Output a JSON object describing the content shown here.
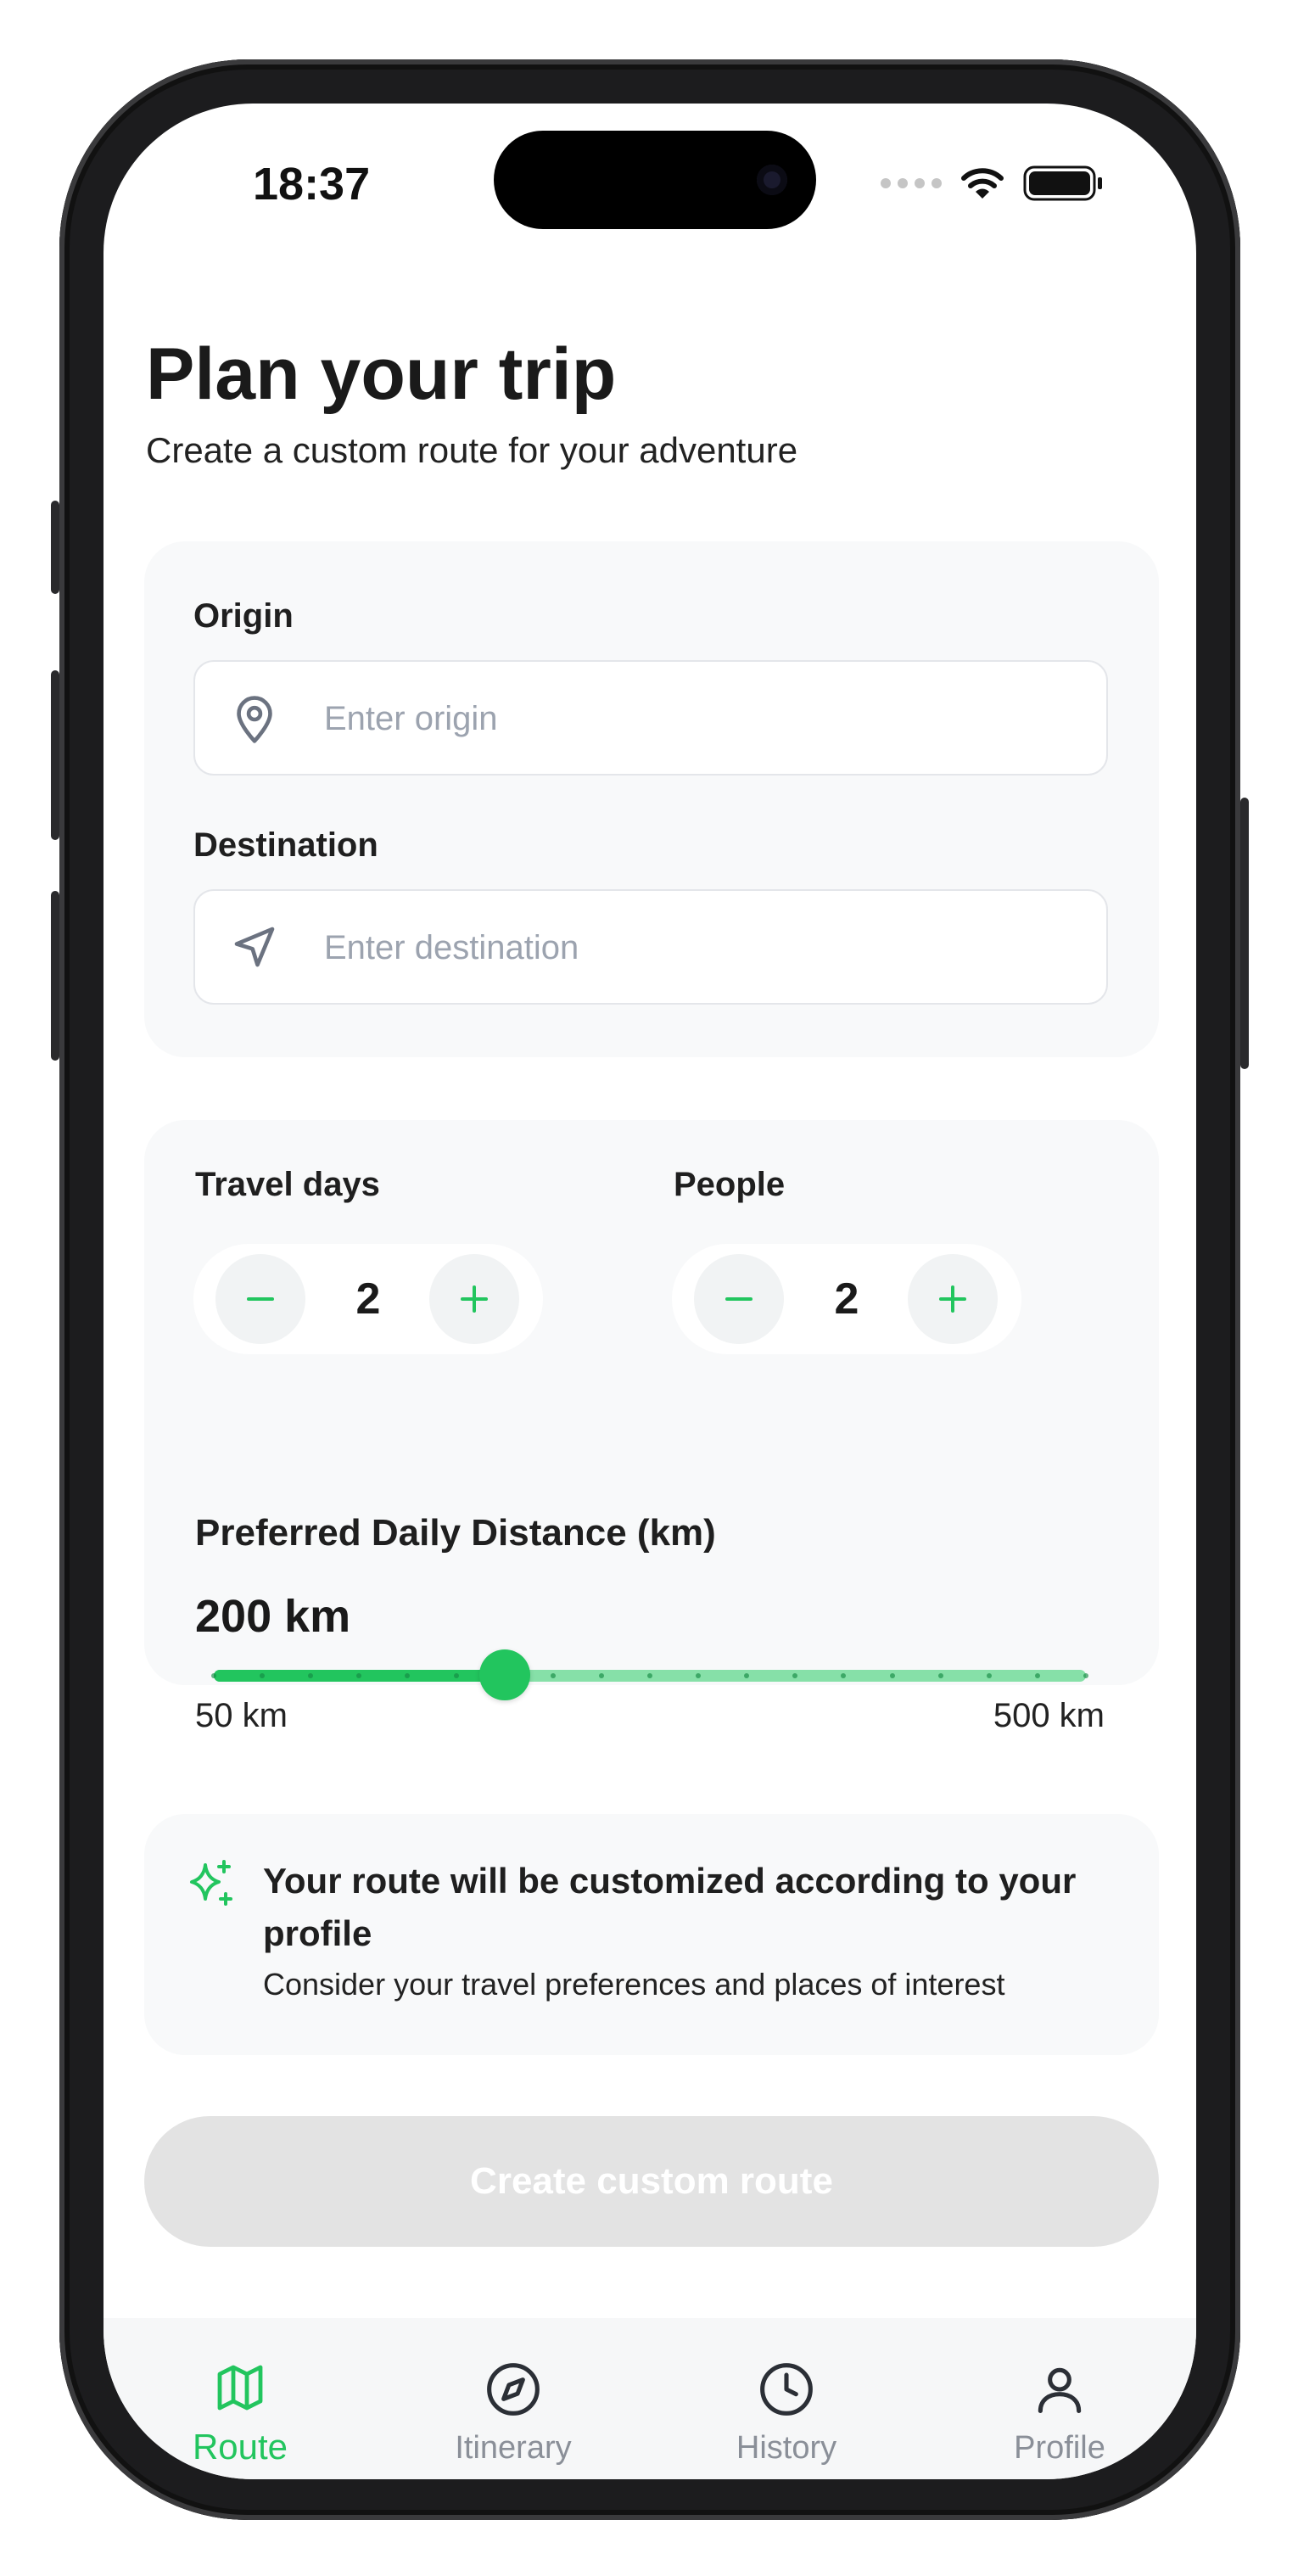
{
  "status_bar": {
    "time": "18:37"
  },
  "header": {
    "title": "Plan your trip",
    "subtitle": "Create a custom route for your adventure"
  },
  "locations": {
    "origin_label": "Origin",
    "origin_placeholder": "Enter origin",
    "origin_value": "",
    "destination_label": "Destination",
    "destination_placeholder": "Enter destination",
    "destination_value": ""
  },
  "options": {
    "travel_days": {
      "label": "Travel days",
      "value": "2",
      "decrement": "−",
      "increment": "+"
    },
    "people": {
      "label": "People",
      "value": "2",
      "decrement": "−",
      "increment": "+"
    },
    "distance": {
      "label": "Preferred Daily Distance (km)",
      "value_text": "200 km",
      "value": 200,
      "min": 50,
      "max": 500,
      "step": 25,
      "min_label": "50 km",
      "max_label": "500 km"
    }
  },
  "info": {
    "icon": "sparkles-icon",
    "title": "Your route will be customized according to your profile",
    "description": "Consider your travel preferences and places of interest"
  },
  "cta": {
    "label": "Create custom route",
    "disabled": true
  },
  "tabbar": {
    "items": [
      {
        "label": "Route",
        "icon": "map-icon",
        "active": true
      },
      {
        "label": "Itinerary",
        "icon": "compass-icon",
        "active": false
      },
      {
        "label": "History",
        "icon": "clock-icon",
        "active": false
      },
      {
        "label": "Profile",
        "icon": "user-icon",
        "active": false
      }
    ]
  },
  "colors": {
    "accent": "#22c55e",
    "accent_light": "#86e0a8",
    "card_bg": "#f8f9fa",
    "muted_text": "#8a8f98",
    "disabled_button": "#e3e3e3"
  }
}
